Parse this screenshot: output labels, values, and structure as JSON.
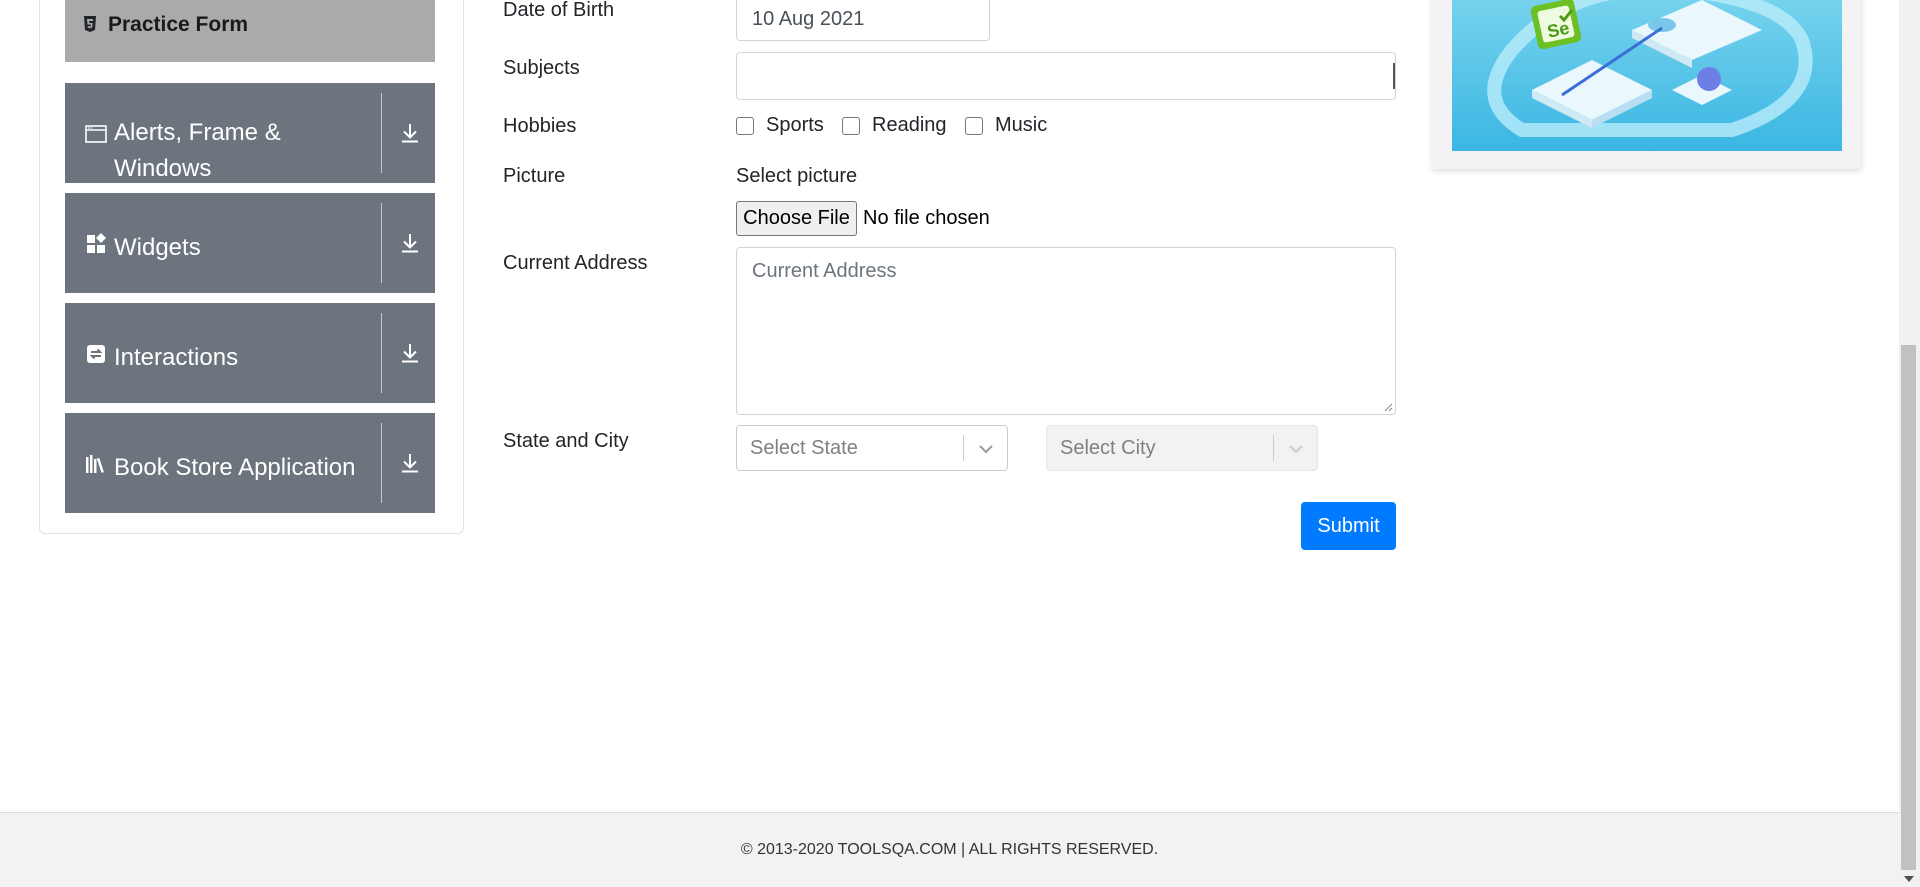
{
  "sidebar": {
    "current_item": {
      "label": "Practice Form",
      "icon": "html5-icon"
    },
    "groups": [
      {
        "label": "Alerts, Frame & Windows",
        "icon": "browser-window-icon"
      },
      {
        "label": "Widgets",
        "icon": "widgets-icon"
      },
      {
        "label": "Interactions",
        "icon": "interactions-icon"
      },
      {
        "label": "Book Store Application",
        "icon": "books-icon"
      }
    ]
  },
  "form": {
    "dob": {
      "label": "Date of Birth",
      "value": "10 Aug 2021"
    },
    "subjects": {
      "label": "Subjects",
      "value": ""
    },
    "hobbies": {
      "label": "Hobbies",
      "options": [
        {
          "label": "Sports",
          "checked": false
        },
        {
          "label": "Reading",
          "checked": false
        },
        {
          "label": "Music",
          "checked": false
        }
      ]
    },
    "picture": {
      "label": "Picture",
      "select_label": "Select picture",
      "button": "Choose File",
      "status": "No file chosen"
    },
    "address": {
      "label": "Current Address",
      "placeholder": "Current Address"
    },
    "state_city": {
      "label": "State and City",
      "state_placeholder": "Select State",
      "city_placeholder": "Select City"
    },
    "submit": "Submit"
  },
  "footer": {
    "text": "© 2013-2020 TOOLSQA.COM | ALL RIGHTS RESERVED."
  },
  "colors": {
    "primary": "#007bff",
    "sidebar_group": "#6c757d",
    "sidebar_active": "#aaaaaa"
  }
}
